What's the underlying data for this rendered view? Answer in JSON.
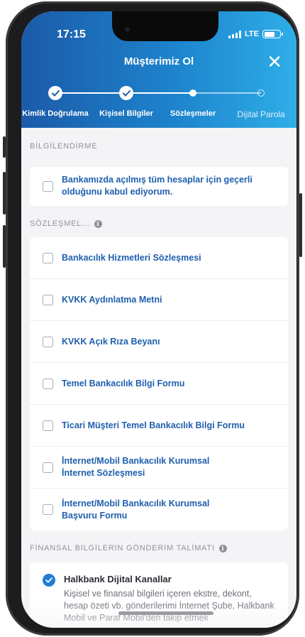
{
  "status_bar": {
    "time": "17:15",
    "network": "LTE"
  },
  "header": {
    "title": "Müşterimiz Ol",
    "close_icon": "close-icon"
  },
  "stepper": {
    "steps": [
      {
        "label": "Kimlik Doğrulama",
        "state": "done"
      },
      {
        "label": "Kişisel Bilgiler",
        "state": "done"
      },
      {
        "label": "Sözleşmeler",
        "state": "current"
      },
      {
        "label": "Dijital Parola",
        "state": "pending"
      }
    ]
  },
  "bilgilendirme": {
    "section_title": "BİLGİLENDİRME",
    "text": "Bankamızda açılmış tüm hesaplar için geçerli olduğunu kabul ediyorum."
  },
  "sozlesmeler": {
    "section_title": "SÖZLEŞMEL...",
    "items": [
      "Bankacılık Hizmetleri Sözleşmesi",
      "KVKK Aydınlatma Metni",
      "KVKK Açık Rıza Beyanı",
      "Temel Bankacılık Bilgi Formu",
      "Ticari Müşteri Temel Bankacılık Bilgi Formu",
      "İnternet/Mobil Bankacılık Kurumsal İnternet Sözleşmesi",
      "İnternet/Mobil Bankacılık Kurumsal Başvuru Formu"
    ]
  },
  "finansal": {
    "section_title": "FİNANSAL BİLGİLERİN GÖNDERİM TALİMATI",
    "option_title": "Halkbank Dijital Kanallar",
    "option_desc": "Kişisel ve finansal bilgileri içeren ekstre, dekont, hesap özeti vb. gönderilerimi İnternet Şube, Halkbank Mobil ve Paraf Mobil'den takip etmek"
  },
  "colors": {
    "header_start": "#1c5aa9",
    "header_end": "#2eaee8",
    "link_text": "#1f5fae",
    "check_blue": "#1f7ed6"
  }
}
